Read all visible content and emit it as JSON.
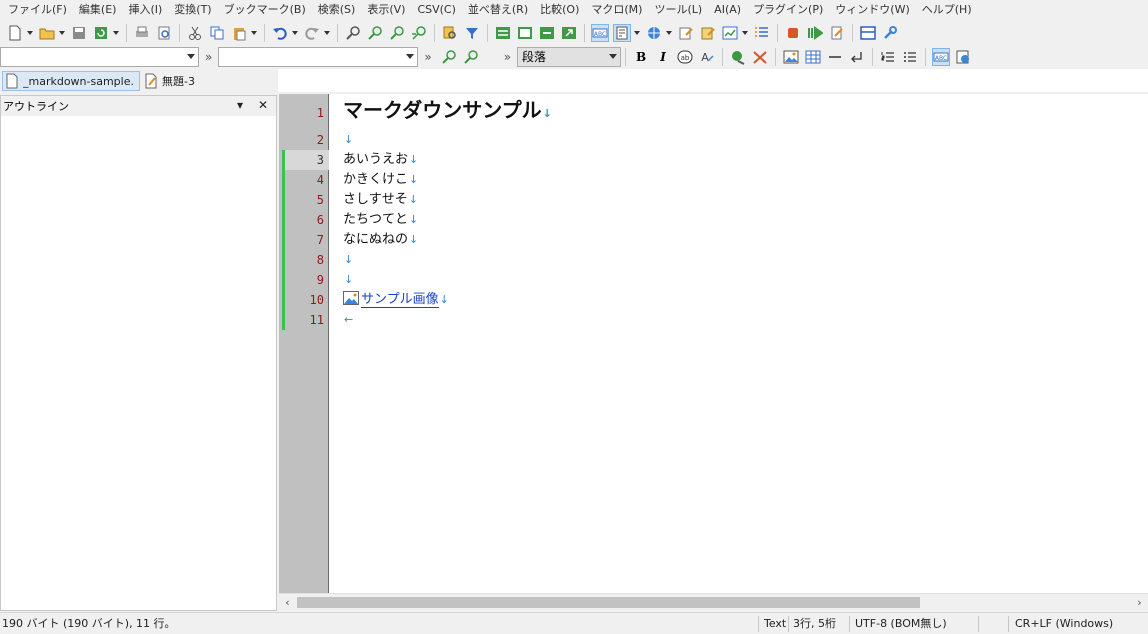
{
  "menu": [
    "ファイル(F)",
    "編集(E)",
    "挿入(I)",
    "変換(T)",
    "ブックマーク(B)",
    "検索(S)",
    "表示(V)",
    "CSV(C)",
    "並べ替え(R)",
    "比較(O)",
    "マクロ(M)",
    "ツール(L)",
    "AI(A)",
    "プラグイン(P)",
    "ウィンドウ(W)",
    "ヘルプ(H)"
  ],
  "toolbar2": {
    "paragraph_style": "段落",
    "chevron": "»"
  },
  "tabs": [
    {
      "label": "_markdown-sample.",
      "active": true
    },
    {
      "label": "無題-3",
      "active": false
    }
  ],
  "outline": {
    "title": "アウトライン",
    "pin": "▾",
    "close": "✕"
  },
  "editor": {
    "line_numbers": [
      "1",
      "2",
      "3",
      "4",
      "5",
      "6",
      "7",
      "8",
      "9",
      "10",
      "11"
    ],
    "eol_mark": "↓",
    "eof_mark": "←",
    "lines": [
      {
        "text": "マークダウンサンプル",
        "heading": true
      },
      {
        "text": ""
      },
      {
        "text": "あいうえお"
      },
      {
        "text": "かきくけこ"
      },
      {
        "text": "さしすせそ"
      },
      {
        "text": "たちつてと"
      },
      {
        "text": "なにぬねの"
      },
      {
        "text": ""
      },
      {
        "text": ""
      },
      {
        "text": "サンプル画像",
        "link": true
      },
      {
        "text": ""
      }
    ]
  },
  "status": {
    "size": "190 バイト (190 バイト), 11 行。",
    "mode": "Text",
    "position": "3行, 5桁",
    "encoding": "UTF-8 (BOM無し)",
    "newline": "CR+LF (Windows)"
  },
  "colors": {
    "change_mark": "#3bc24a",
    "gutter": "#c0c0c0",
    "line_number": "#8b1a1a",
    "eol": "#3a86d8",
    "link": "#1a3fcc"
  }
}
